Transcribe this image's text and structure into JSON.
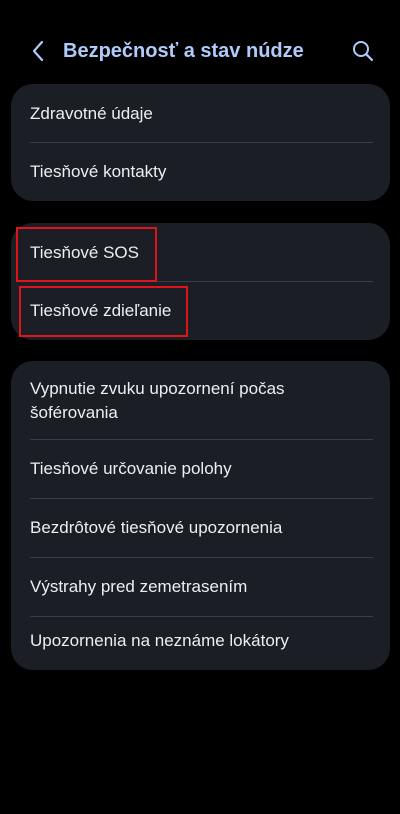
{
  "header": {
    "title": "Bezpečnosť a stav núdze",
    "back_icon": "chevron-left-icon",
    "search_icon": "search-icon",
    "title_color": "#AECBFA"
  },
  "groups": [
    {
      "items": [
        {
          "label": "Zdravotné údaje"
        },
        {
          "label": "Tiesňové kontakty"
        }
      ]
    },
    {
      "items": [
        {
          "label": "Tiesňové SOS"
        },
        {
          "label": "Tiesňové zdieľanie"
        }
      ]
    },
    {
      "items": [
        {
          "label": "Vypnutie zvuku upozornení počas šoférovania"
        },
        {
          "label": "Tiesňové určovanie polohy"
        },
        {
          "label": "Bezdrôtové tiesňové upozornenia"
        },
        {
          "label": "Výstrahy pred zemetrasením"
        },
        {
          "label": "Upozornenia na neznáme lokátory"
        }
      ]
    }
  ],
  "colors": {
    "background": "#000000",
    "card": "#1B1F25",
    "text": "#ECEEF1",
    "highlight": "#E0151C"
  }
}
